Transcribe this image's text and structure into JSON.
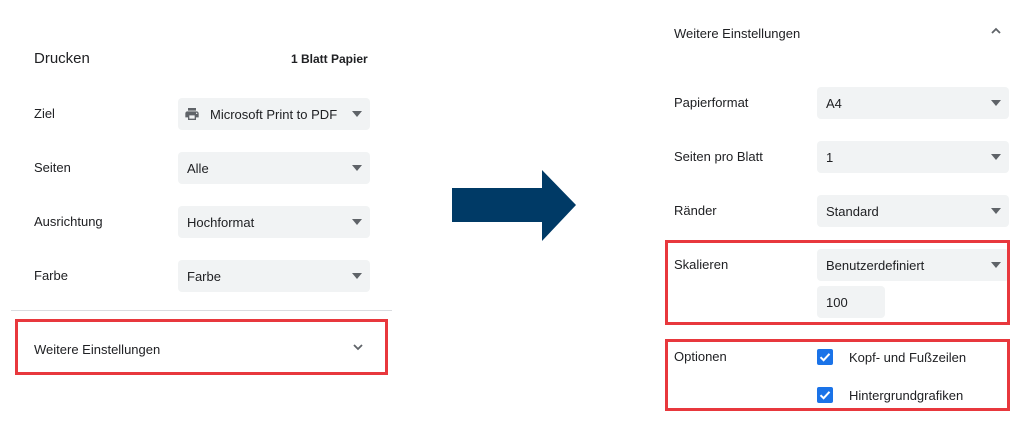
{
  "left": {
    "title": "Drucken",
    "sheets": "1 Blatt Papier",
    "rows": [
      {
        "label": "Ziel",
        "value": "Microsoft Print to PDF"
      },
      {
        "label": "Seiten",
        "value": "Alle"
      },
      {
        "label": "Ausrichtung",
        "value": "Hochformat"
      },
      {
        "label": "Farbe",
        "value": "Farbe"
      }
    ],
    "more_settings": "Weitere Einstellungen"
  },
  "right": {
    "more_settings": "Weitere Einstellungen",
    "rows": [
      {
        "label": "Papierformat",
        "value": "A4"
      },
      {
        "label": "Seiten pro Blatt",
        "value": "1"
      },
      {
        "label": "Ränder",
        "value": "Standard"
      },
      {
        "label": "Skalieren",
        "value": "Benutzerdefiniert"
      }
    ],
    "scale_value": "100",
    "options_label": "Optionen",
    "options": [
      {
        "label": "Kopf- und Fußzeilen",
        "checked": true
      },
      {
        "label": "Hintergrundgrafiken",
        "checked": true
      }
    ]
  },
  "colors": {
    "highlight": "#e8383d",
    "arrow": "#003a66",
    "checkbox": "#1a73e8"
  },
  "icons": [
    "printer-icon",
    "chevron-down-icon",
    "chevron-up-icon",
    "dropdown-caret-icon",
    "check-icon",
    "right-arrow-icon"
  ]
}
